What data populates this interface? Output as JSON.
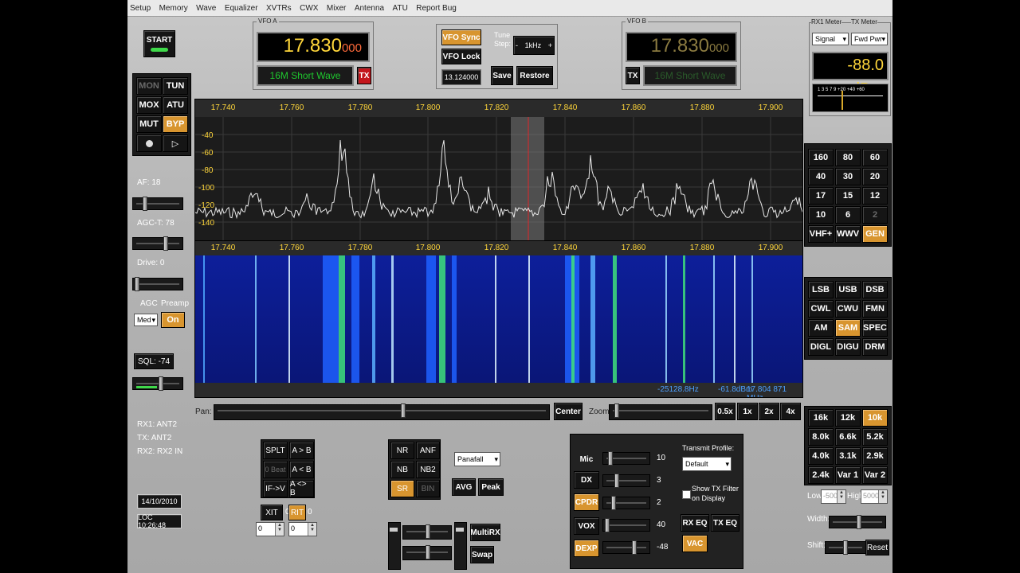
{
  "menu": [
    "Setup",
    "Memory",
    "Wave",
    "Equalizer",
    "XVTRs",
    "CWX",
    "Mixer",
    "Antenna",
    "ATU",
    "Report Bug"
  ],
  "start_button": "START",
  "left_buttons": {
    "mon": "MON",
    "tun": "TUN",
    "mox": "MOX",
    "atu": "ATU",
    "mut": "MUT",
    "byp": "BYP",
    "play": "▷"
  },
  "af_label": "AF:  18",
  "agct_label": "AGC-T:  78",
  "drive_label": "Drive:  0",
  "agc_label": "AGC",
  "preamp_label": "Preamp",
  "agc_value": "Med",
  "preamp_value": "On",
  "sql_label": "SQL:  -74",
  "rx_info": [
    "RX1: ANT2",
    "TX: ANT2",
    "RX2: RX2 IN"
  ],
  "date": "14/10/2010",
  "time": "LOC  10:26:48",
  "vfo_a": {
    "title": "VFO A",
    "freq_main": "17.830",
    "freq_sub": "000",
    "band": "16M Short Wave",
    "tx": "TX"
  },
  "vfo_b": {
    "title": "VFO B",
    "freq_main": "17.830",
    "freq_sub": "000",
    "band": "16M Short Wave",
    "tx": "TX"
  },
  "vfo_sync": "VFO Sync",
  "vfo_lock": "VFO Lock",
  "tune_step_label": "Tune\nStep:",
  "tune_step_value": "1kHz",
  "mem_freq": "13.124000",
  "save": "Save",
  "restore": "Restore",
  "meter": {
    "rx_title": "RX1 Meter",
    "tx_title": "TX Meter",
    "rx_sel": "Signal",
    "tx_sel": "Fwd Pwr",
    "reading": "-88.0 dBm",
    "scale": "1 3 5 7 9   +20 +40 +60"
  },
  "spectrum": {
    "freq_ticks": [
      "17.740",
      "17.760",
      "17.780",
      "17.800",
      "17.820",
      "17.840",
      "17.860",
      "17.880",
      "17.900"
    ],
    "db_ticks": [
      "-40",
      "-60",
      "-80",
      "-100",
      "-120",
      "-140"
    ]
  },
  "waterfall_status": [
    "-25128.8Hz",
    "-61.8dBm",
    "17.804 871 MHz"
  ],
  "bands": [
    "160",
    "80",
    "60",
    "40",
    "30",
    "20",
    "17",
    "15",
    "12",
    "10",
    "6",
    "2",
    "VHF+",
    "WWV",
    "GEN"
  ],
  "modes": [
    "LSB",
    "USB",
    "DSB",
    "CWL",
    "CWU",
    "FMN",
    "AM",
    "SAM",
    "SPEC",
    "DIGL",
    "DIGU",
    "DRM"
  ],
  "filters": [
    "16k",
    "12k",
    "10k",
    "8.0k",
    "6.6k",
    "5.2k",
    "4.0k",
    "3.1k",
    "2.9k",
    "2.4k",
    "Var 1",
    "Var 2"
  ],
  "filter_low_label": "Low",
  "filter_high_label": "High",
  "filter_low": "-5000",
  "filter_high": "5000",
  "width_label": "Width:",
  "shift_label": "Shift:",
  "reset": "Reset",
  "pan_label": "Pan:",
  "center": "Center",
  "zoom_label": "Zoom:",
  "zoom_buttons": [
    "0.5x",
    "1x",
    "2x",
    "4x"
  ],
  "split_buttons": [
    "SPLT",
    "A > B",
    "0 Beat",
    "A < B",
    "IF->V",
    "A <> B"
  ],
  "xit": "XIT",
  "xit_val": "0",
  "rit": "RIT",
  "rit_val": "0",
  "xit_input": "0",
  "rit_input": "0",
  "dsp_buttons": [
    "NR",
    "ANF",
    "NB",
    "NB2",
    "SR",
    "BIN"
  ],
  "display_mode": "Panafall",
  "avg": "AVG",
  "peak": "Peak",
  "multirx": "MultiRX",
  "swap": "Swap",
  "tx_rows": [
    {
      "label": "Mic",
      "value": "10"
    },
    {
      "label": "DX",
      "value": "3"
    },
    {
      "label": "CPDR",
      "value": "2"
    },
    {
      "label": "VOX",
      "value": "40"
    },
    {
      "label": "DEXP",
      "value": "-48"
    }
  ],
  "transmit_profile_label": "Transmit Profile:",
  "transmit_profile": "Default",
  "show_tx_filter": "Show TX Filter\non Display",
  "rx_eq": "RX EQ",
  "tx_eq": "TX EQ",
  "vac": "VAC",
  "colors": {
    "accent": "#d8952f",
    "freq": "#ffd63a",
    "band_text": "#1ec92e",
    "spectrum_bg": "#1c1c1c",
    "waterfall_bg": "#0a1a8c"
  }
}
